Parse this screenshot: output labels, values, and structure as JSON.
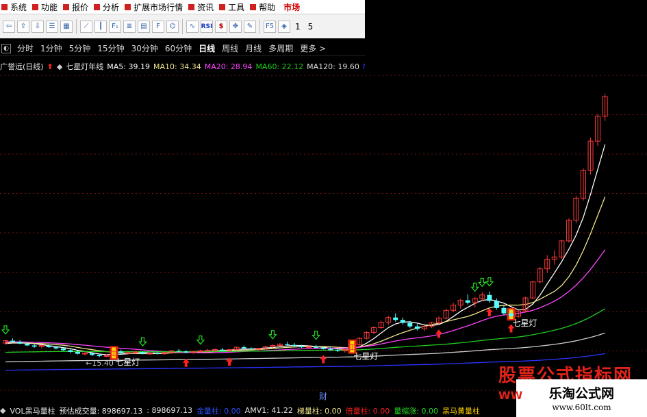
{
  "menu": {
    "items": [
      "系统",
      "功能",
      "报价",
      "分析",
      "扩展市场行情",
      "资讯",
      "工具",
      "帮助"
    ],
    "active": "市场"
  },
  "toolbar": {
    "buttons": [
      "back-icon",
      "up-icon",
      "down-icon",
      "list-icon",
      "grid-icon",
      "line-chart-icon",
      "kline-icon",
      "f10-icon",
      "news-icon",
      "calc-icon",
      "fiz-icon",
      "lab-icon",
      "wave-icon",
      "rsi-icon",
      "dollar-icon",
      "move-icon",
      "pencil-icon",
      "f5-icon",
      "f6-icon"
    ],
    "rsi_label": "RSI",
    "dollar_label": "$",
    "f5_label": "F5",
    "num1": "1",
    "num2": "5"
  },
  "period": {
    "toggle": "◐",
    "items": [
      "分时",
      "1分钟",
      "5分钟",
      "15分钟",
      "30分钟",
      "60分钟",
      "日线",
      "周线",
      "月线",
      "多周期",
      "更多 >"
    ],
    "active_index": 6
  },
  "indicators": {
    "stock": "广誉远(日线)",
    "arrow": "⬆",
    "formula": "七星灯年线",
    "ma5": "MA5: 39.19",
    "ma10": "MA10: 34.34",
    "ma20": "MA20: 28.94",
    "ma60": "MA60: 22.12",
    "ma120": "MA120: 19.60",
    "ma_tail": "MA"
  },
  "volume": {
    "name": "VOL黑马量柱",
    "est": "预估成交量: 898697.13",
    "est2": ": 898697.13",
    "gold": "金量柱: 0.00",
    "amv": "AMV1: 41.22",
    "ladder": "梯量柱: 0.00",
    "double": "倍量柱: 0.00",
    "shrink": "量缩涨: 0.00",
    "horse": "黑马黄量柱"
  },
  "annotations": {
    "lamp1": "七星灯",
    "lamp2": "七星灯",
    "lamp3": "七星灯",
    "low": "←15.40",
    "cai": "财"
  },
  "watermark": {
    "big": "股票公式指标网",
    "title": "乐淘公式网",
    "url": "www.60lt.com",
    "ww": "WW"
  },
  "colors": {
    "up": "#ff3b3b",
    "down": "#54ffff",
    "ma5": "#ffffff",
    "ma10": "#f0e68c",
    "ma20": "#ff45ff",
    "ma60": "#22cc22",
    "ma120": "#cccccc",
    "ma250": "#2a34ff",
    "signal_up": "#ff2020",
    "signal_down": "#22dd22",
    "lamp": "#ffd200"
  },
  "chart_data": {
    "type": "candlestick",
    "price_range": [
      11,
      60
    ],
    "candles": [
      [
        17.8,
        18.4,
        17.5,
        18.2
      ],
      [
        18.2,
        18.6,
        17.9,
        18.0
      ],
      [
        18.0,
        18.3,
        17.6,
        17.7
      ],
      [
        17.7,
        17.9,
        17.3,
        17.4
      ],
      [
        17.4,
        17.6,
        17.0,
        17.2
      ],
      [
        17.2,
        17.5,
        16.9,
        17.4
      ],
      [
        17.4,
        17.7,
        17.0,
        17.1
      ],
      [
        17.1,
        17.3,
        16.7,
        16.9
      ],
      [
        16.9,
        17.1,
        16.5,
        16.6
      ],
      [
        16.6,
        16.8,
        16.1,
        16.3
      ],
      [
        16.3,
        16.5,
        15.9,
        16.0
      ],
      [
        16.0,
        16.3,
        15.7,
        16.1
      ],
      [
        16.1,
        16.2,
        15.6,
        15.8
      ],
      [
        15.8,
        16.0,
        15.4,
        15.6
      ],
      [
        15.6,
        15.9,
        15.4,
        15.7
      ],
      [
        15.7,
        16.5,
        15.6,
        16.4
      ],
      [
        16.4,
        16.7,
        16.0,
        16.1
      ],
      [
        16.1,
        16.3,
        15.9,
        16.2
      ],
      [
        16.2,
        16.5,
        16.0,
        16.3
      ],
      [
        16.3,
        16.4,
        15.9,
        16.0
      ],
      [
        16.0,
        16.2,
        15.8,
        16.1
      ],
      [
        16.1,
        16.4,
        15.9,
        16.0
      ],
      [
        16.0,
        16.3,
        15.8,
        16.2
      ],
      [
        16.2,
        16.6,
        16.0,
        16.5
      ],
      [
        16.5,
        16.8,
        16.3,
        16.4
      ],
      [
        16.4,
        16.6,
        16.1,
        16.2
      ],
      [
        16.2,
        16.5,
        16.0,
        16.4
      ],
      [
        16.4,
        16.7,
        16.2,
        16.5
      ],
      [
        16.5,
        16.8,
        16.3,
        16.6
      ],
      [
        16.6,
        16.9,
        16.4,
        16.7
      ],
      [
        16.7,
        17.0,
        16.4,
        16.5
      ],
      [
        16.5,
        16.8,
        16.3,
        16.7
      ],
      [
        16.7,
        17.2,
        16.6,
        17.1
      ],
      [
        17.1,
        17.4,
        16.8,
        16.9
      ],
      [
        16.9,
        17.1,
        16.6,
        16.8
      ],
      [
        16.8,
        17.0,
        16.5,
        16.9
      ],
      [
        16.9,
        17.3,
        16.7,
        17.2
      ],
      [
        17.2,
        17.6,
        17.0,
        17.4
      ],
      [
        17.4,
        17.8,
        17.2,
        17.6
      ],
      [
        17.6,
        18.0,
        17.3,
        17.5
      ],
      [
        17.5,
        17.8,
        17.2,
        17.3
      ],
      [
        17.3,
        17.5,
        17.0,
        17.1
      ],
      [
        17.1,
        17.4,
        16.9,
        17.2
      ],
      [
        17.2,
        17.5,
        16.9,
        17.0
      ],
      [
        17.0,
        17.2,
        16.7,
        16.8
      ],
      [
        16.8,
        17.1,
        16.5,
        16.6
      ],
      [
        16.6,
        16.9,
        16.3,
        16.5
      ],
      [
        16.5,
        16.8,
        16.2,
        16.7
      ],
      [
        16.7,
        17.6,
        16.6,
        17.5
      ],
      [
        17.5,
        18.8,
        17.4,
        18.6
      ],
      [
        18.6,
        19.8,
        18.4,
        19.6
      ],
      [
        19.6,
        20.6,
        19.3,
        20.4
      ],
      [
        20.4,
        21.6,
        20.2,
        21.3
      ],
      [
        21.3,
        22.4,
        20.8,
        22.1
      ],
      [
        22.1,
        22.8,
        21.4,
        21.7
      ],
      [
        21.7,
        22.1,
        20.9,
        21.2
      ],
      [
        21.2,
        21.5,
        20.3,
        20.6
      ],
      [
        20.6,
        21.0,
        19.9,
        20.2
      ],
      [
        20.2,
        20.8,
        19.8,
        20.6
      ],
      [
        20.6,
        21.4,
        20.3,
        21.2
      ],
      [
        21.2,
        22.3,
        21.0,
        22.0
      ],
      [
        22.0,
        23.6,
        21.8,
        23.3
      ],
      [
        23.3,
        24.6,
        23.0,
        24.2
      ],
      [
        24.2,
        25.3,
        23.6,
        25.0
      ],
      [
        25.0,
        26.0,
        24.3,
        24.6
      ],
      [
        24.6,
        25.6,
        23.8,
        25.3
      ],
      [
        25.3,
        26.4,
        24.8,
        25.9
      ],
      [
        25.9,
        26.5,
        24.6,
        24.9
      ],
      [
        24.9,
        25.3,
        23.4,
        23.7
      ],
      [
        23.7,
        24.1,
        22.5,
        22.8
      ],
      [
        22.8,
        23.3,
        21.9,
        22.3
      ],
      [
        22.3,
        23.4,
        22.0,
        23.2
      ],
      [
        23.2,
        25.6,
        23.0,
        25.4
      ],
      [
        25.4,
        28.3,
        25.2,
        28.1
      ],
      [
        28.1,
        30.6,
        27.8,
        30.3
      ],
      [
        30.3,
        32.6,
        29.6,
        31.9
      ],
      [
        31.9,
        33.4,
        31.0,
        32.3
      ],
      [
        32.3,
        35.2,
        32.0,
        35.0
      ],
      [
        35.0,
        38.8,
        34.7,
        38.5
      ],
      [
        38.5,
        42.6,
        38.0,
        42.2
      ],
      [
        42.2,
        47.2,
        41.8,
        46.9
      ],
      [
        46.9,
        52.4,
        46.2,
        51.8
      ],
      [
        51.8,
        56.4,
        51.0,
        56.0
      ],
      [
        56.0,
        59.8,
        55.2,
        59.3
      ]
    ],
    "ma_lines": [
      {
        "name": "MA5",
        "value": 39.19
      },
      {
        "name": "MA10",
        "value": 34.34
      },
      {
        "name": "MA20",
        "value": 28.94
      },
      {
        "name": "MA60",
        "value": 22.12
      },
      {
        "name": "MA120",
        "value": 19.6
      }
    ],
    "lamp_candles": [
      15,
      48,
      70
    ],
    "up_arrows": [
      25,
      31,
      44,
      60,
      67,
      70
    ],
    "down_arrows": [
      0,
      19,
      27,
      37,
      43,
      65,
      66,
      67
    ],
    "volume": {
      "amv1": 41.22
    }
  }
}
